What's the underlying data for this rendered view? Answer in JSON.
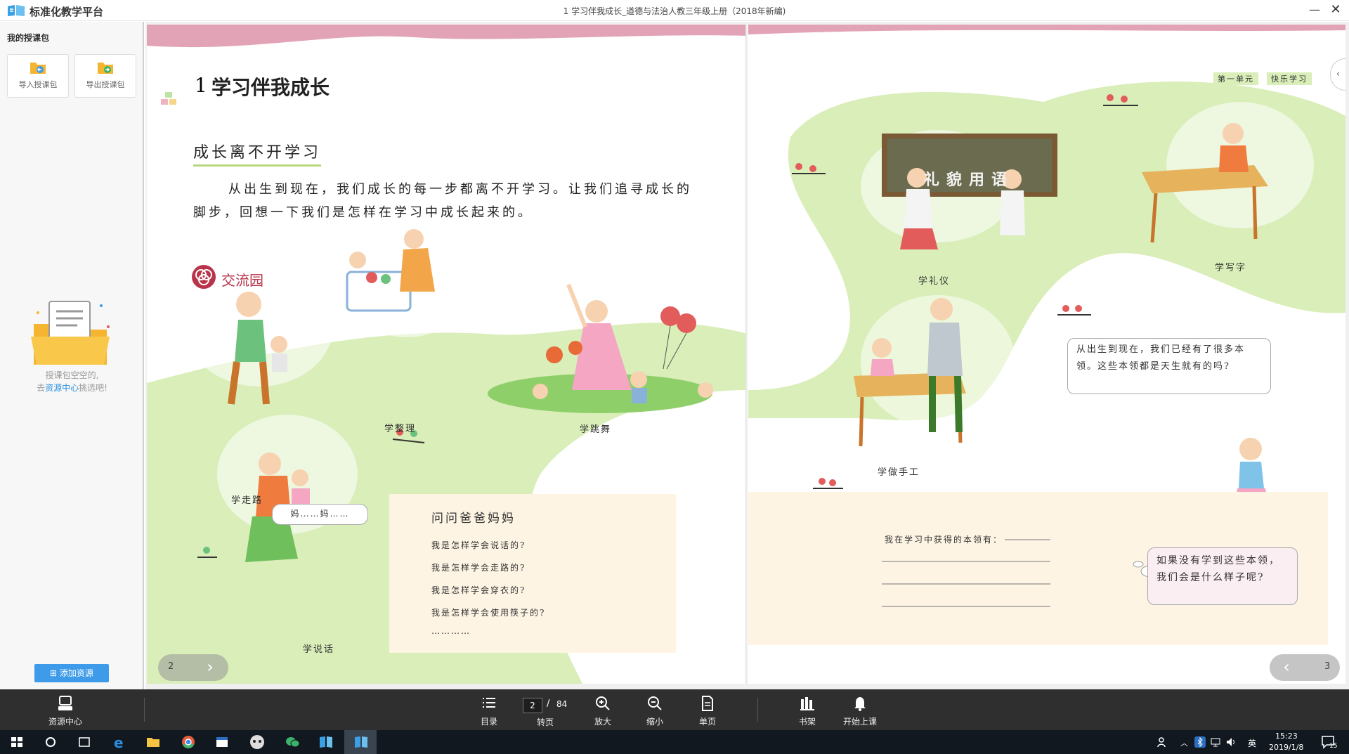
{
  "app": {
    "name": "标准化教学平台",
    "window_title": "1 学习伴我成长_道德与法治人教三年级上册（2018年新编)"
  },
  "sidebar": {
    "title": "我的授课包",
    "import_label": "导入授课包",
    "export_label": "导出授课包",
    "empty_line1": "授课包空空的,",
    "empty_prefix": "去",
    "empty_link": "资源中心",
    "empty_suffix": "挑选吧!",
    "add_resource": "添加资源"
  },
  "book": {
    "header_unit": "第一单元",
    "header_topic": "快乐学习",
    "lesson_number": "1",
    "lesson_title": "学习伴我成长",
    "section_title": "成长离不开学习",
    "intro": "从出生到现在，我们成长的每一步都离不开学习。让我们追寻成长的脚步，回想一下我们是怎样在学习中成长起来的。",
    "exchange_label": "交流园",
    "captions": {
      "walk": "学走路",
      "tidy": "学整理",
      "dance": "学跳舞",
      "talk": "学说话",
      "etiquette": "学礼仪",
      "write": "学写字",
      "craft": "学做手工"
    },
    "blackboard": "礼貌用语",
    "mom_bubble": "妈……妈……",
    "ask_box": {
      "title": "问问爸爸妈妈",
      "questions": [
        "我是怎样学会说话的?",
        "我是怎样学会走路的?",
        "我是怎样学会穿衣的?",
        "我是怎样学会使用筷子的?",
        "…………"
      ]
    },
    "skills_prompt": "我在学习中获得的本领有：",
    "girl_bubble": "从出生到现在，我们已经有了很多本领。这些本领都是天生就有的吗?",
    "think_bubble": "如果没有学到这些本领，我们会是什么样子呢?",
    "left_page_num": "2",
    "right_page_num": "3"
  },
  "toolbar": {
    "resource_center": "资源中心",
    "toc": "目录",
    "current_page": "2",
    "page_sep": "/",
    "total_pages": "84",
    "goto_page": "转页",
    "zoom_in": "放大",
    "zoom_out": "缩小",
    "single_page": "单页",
    "bookshelf": "书架",
    "start_class": "开始上课"
  },
  "taskbar": {
    "ime": "英",
    "time": "15:23",
    "date": "2019/1/8",
    "notif_count": "15"
  },
  "colors": {
    "accent_blue": "#3d9be9",
    "section_red": "#b8344a",
    "page_green": "#d9eeb8",
    "box_cream": "#fdf4e4",
    "toolbar_dark": "#2f2f2f"
  }
}
